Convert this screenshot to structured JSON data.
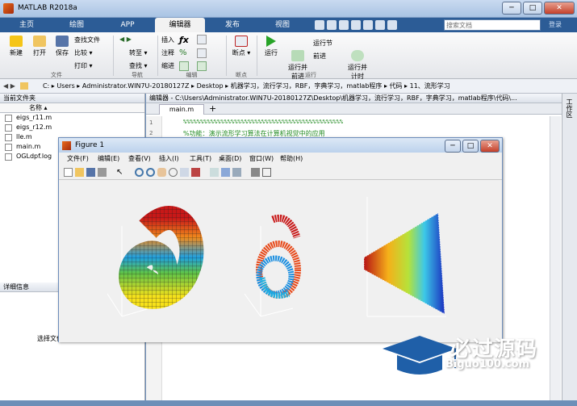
{
  "window": {
    "title": "MATLAB R2018a",
    "search_placeholder": "搜索文档",
    "signin": "登录"
  },
  "tabs": [
    "主页",
    "绘图",
    "APP",
    "编辑器",
    "发布",
    "视图"
  ],
  "active_tab": 3,
  "toolstrip": {
    "file": {
      "new": "新建",
      "open": "打开",
      "save": "保存",
      "find_files": "查找文件",
      "compare": "比较",
      "print": "打印",
      "section": "文件"
    },
    "nav": {
      "goto": "转至",
      "find": "查找",
      "section": "导航"
    },
    "edit": {
      "insert": "插入",
      "comment": "注释",
      "indent": "缩进",
      "section": "编辑"
    },
    "breakpoints": {
      "label": "断点",
      "section": "断点"
    },
    "run": {
      "run": "运行",
      "run_advance": "运行并\n前进",
      "run_section": "运行节",
      "advance": "前进",
      "run_time": "运行并\n计时",
      "section": "运行"
    }
  },
  "address": {
    "parts": [
      "C:",
      "Users",
      "Administrator.WIN7U-20180127Z",
      "Desktop",
      "机器学习，流行学习，RBF，字典学习，matlab程序",
      "代码",
      "11、流形学习"
    ]
  },
  "current_folder": {
    "title": "当前文件夹",
    "col_name": "名称",
    "files": [
      "eigs_r11.m",
      "eigs_r12.m",
      "lle.m",
      "main.m",
      "OGLdpf.log"
    ]
  },
  "details": {
    "title": "详细信息",
    "hint": "选择文件以查看详细信息"
  },
  "editor": {
    "title": "编辑器 - C:\\Users\\Administrator.WIN7U-20180127Z\\Desktop\\机器学习，流行学习，RBF，字典学习，matlab程序\\代码\\...",
    "tab": "main.m",
    "lines": [
      {
        "n": "1",
        "text": "%%%%%%%%%%%%%%%%%%%%%%%%%%%%%%%%%%%%%%%%%%%%%%%"
      },
      {
        "n": "2",
        "text": "%功能：演示流形学习算法在计算机视觉中的应用"
      },
      {
        "n": "3",
        "text": ""
      }
    ]
  },
  "right_bar": {
    "label": "工作区"
  },
  "figure": {
    "title": "Figure 1",
    "menu": [
      "文件(F)",
      "编辑(E)",
      "查看(V)",
      "插入(I)",
      "工具(T)",
      "桌面(D)",
      "窗口(W)",
      "帮助(H)"
    ]
  },
  "watermark": {
    "brand": "必过源码",
    "url": "Biguo100.com"
  }
}
